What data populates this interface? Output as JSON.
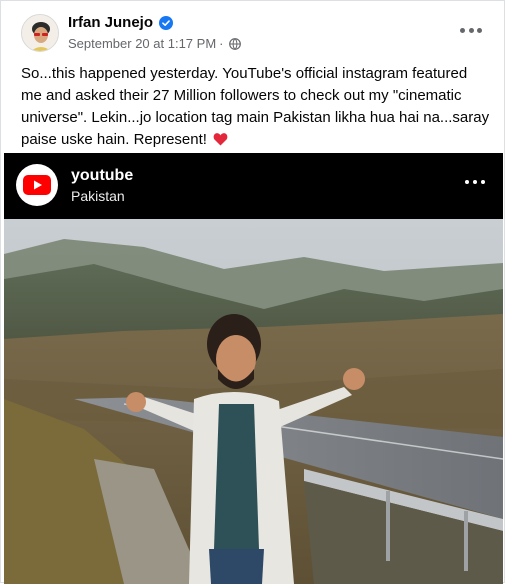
{
  "post": {
    "author": "Irfan Junejo",
    "timestamp": "September 20 at 1:17 PM",
    "separator": "·",
    "text": "So...this happened yesterday. YouTube's official instagram featured me and asked their 27 Million followers to check out my \"cinematic universe\". Lekin...jo location tag main Pakistan likha hua hai na...saray paise uske hain. Represent!",
    "icons": {
      "verified": "verified-badge-icon",
      "audience": "globe-icon",
      "more": "more-options-icon",
      "emoji": "red-heart-icon"
    }
  },
  "embed": {
    "channel_name": "youtube",
    "location": "Pakistan",
    "icons": {
      "logo": "youtube-logo-icon",
      "more": "more-options-icon"
    }
  },
  "colors": {
    "verified_blue": "#1877f2",
    "youtube_red": "#ff0000",
    "heart_red": "#e4283c",
    "meta_gray": "#65676b"
  }
}
